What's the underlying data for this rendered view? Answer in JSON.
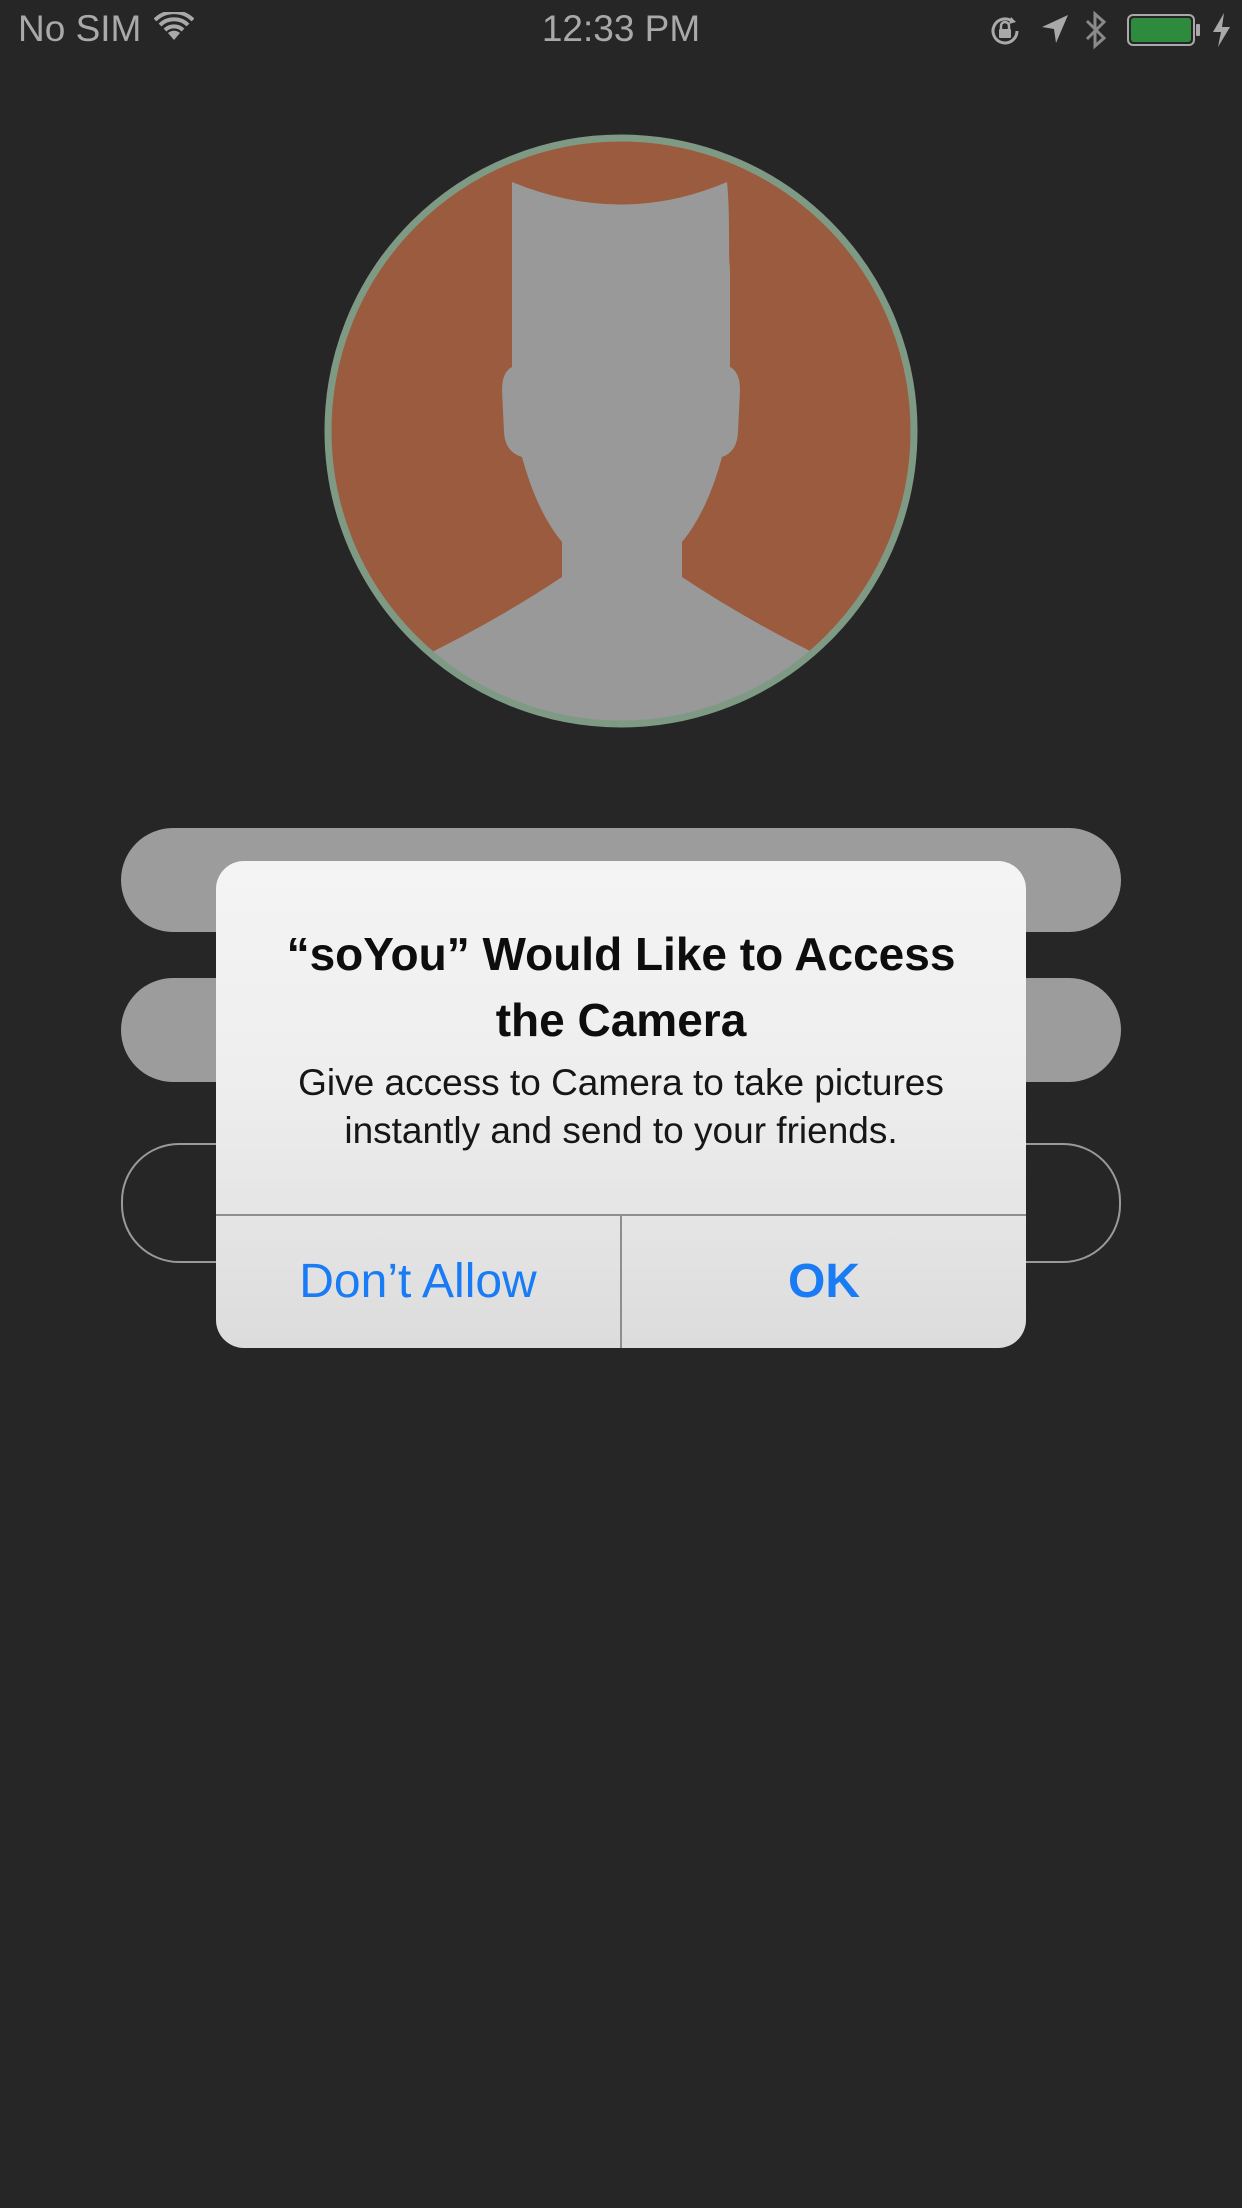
{
  "status_bar": {
    "carrier": "No SIM",
    "time": "12:33 PM",
    "battery_color": "#2e8b3e"
  },
  "profile": {
    "avatar_background": "#9a5b3e",
    "avatar_ring": "#7f9a84",
    "silhouette_color": "#999999"
  },
  "alert": {
    "title": "“soYou” Would Like to Access the Camera",
    "message": "Give access to Camera to take pictures instantly and send to your friends.",
    "deny_label": "Don’t Allow",
    "ok_label": "OK",
    "accent_color": "#1a7cf5"
  }
}
